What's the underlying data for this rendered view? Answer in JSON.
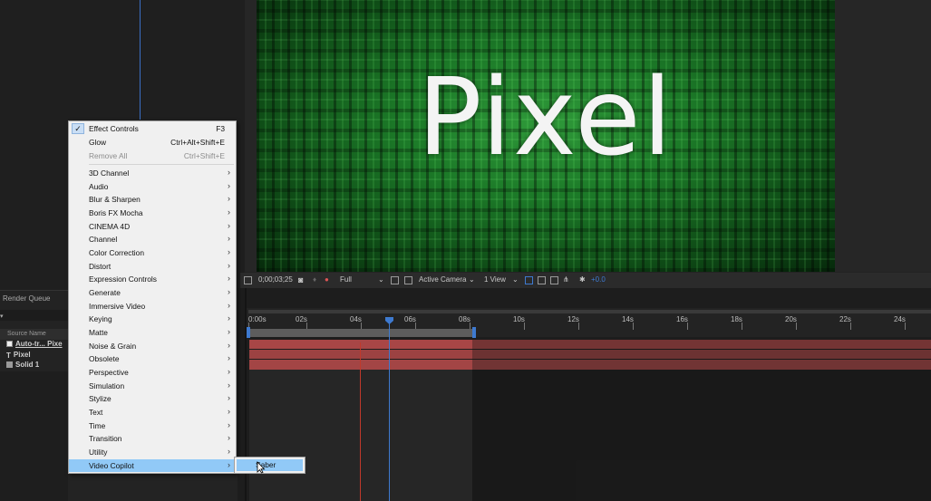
{
  "composition": {
    "text": "Pixel"
  },
  "viewer_toolbar": {
    "timecode": "0;00;03;25",
    "resolution": "Full",
    "camera": "Active Camera",
    "views": "1 View",
    "exposure": "+0.0"
  },
  "project_panel": {
    "render_queue_tab": "Render Queue",
    "source_name_header": "Source Name",
    "layers": [
      {
        "name": "Auto-tr... Pixe",
        "icon": "solid-white-icon"
      },
      {
        "name": "Pixel",
        "icon": "text-layer-icon",
        "icon_glyph": "T"
      },
      {
        "name": "Solid 1",
        "icon": "solid-grey-icon"
      }
    ]
  },
  "timeline": {
    "ticks": [
      "0:00s",
      "02s",
      "04s",
      "06s",
      "08s",
      "10s",
      "12s",
      "14s",
      "16s",
      "18s",
      "20s",
      "22s",
      "24s"
    ]
  },
  "context_menu": {
    "items": [
      {
        "label": "Effect Controls",
        "shortcut": "F3",
        "checked": true
      },
      {
        "label": "Glow",
        "shortcut": "Ctrl+Alt+Shift+E"
      },
      {
        "label": "Remove All",
        "shortcut": "Ctrl+Shift+E",
        "disabled": true
      },
      {
        "label": "3D Channel",
        "submenu": true
      },
      {
        "label": "Audio",
        "submenu": true
      },
      {
        "label": "Blur & Sharpen",
        "submenu": true
      },
      {
        "label": "Boris FX Mocha",
        "submenu": true
      },
      {
        "label": "CINEMA 4D",
        "submenu": true
      },
      {
        "label": "Channel",
        "submenu": true
      },
      {
        "label": "Color Correction",
        "submenu": true
      },
      {
        "label": "Distort",
        "submenu": true
      },
      {
        "label": "Expression Controls",
        "submenu": true
      },
      {
        "label": "Generate",
        "submenu": true
      },
      {
        "label": "Immersive Video",
        "submenu": true
      },
      {
        "label": "Keying",
        "submenu": true
      },
      {
        "label": "Matte",
        "submenu": true
      },
      {
        "label": "Noise & Grain",
        "submenu": true
      },
      {
        "label": "Obsolete",
        "submenu": true
      },
      {
        "label": "Perspective",
        "submenu": true
      },
      {
        "label": "Simulation",
        "submenu": true
      },
      {
        "label": "Stylize",
        "submenu": true
      },
      {
        "label": "Text",
        "submenu": true
      },
      {
        "label": "Time",
        "submenu": true
      },
      {
        "label": "Transition",
        "submenu": true
      },
      {
        "label": "Utility",
        "submenu": true
      },
      {
        "label": "Video Copilot",
        "submenu": true,
        "highlighted": true
      }
    ],
    "submenu_arrow": "›"
  },
  "submenu": {
    "items": [
      {
        "label": "Saber"
      }
    ]
  },
  "colors": {
    "accent_blue": "#3e7ad0",
    "menu_highlight": "#91c9f7",
    "track_red": "#a84646"
  }
}
